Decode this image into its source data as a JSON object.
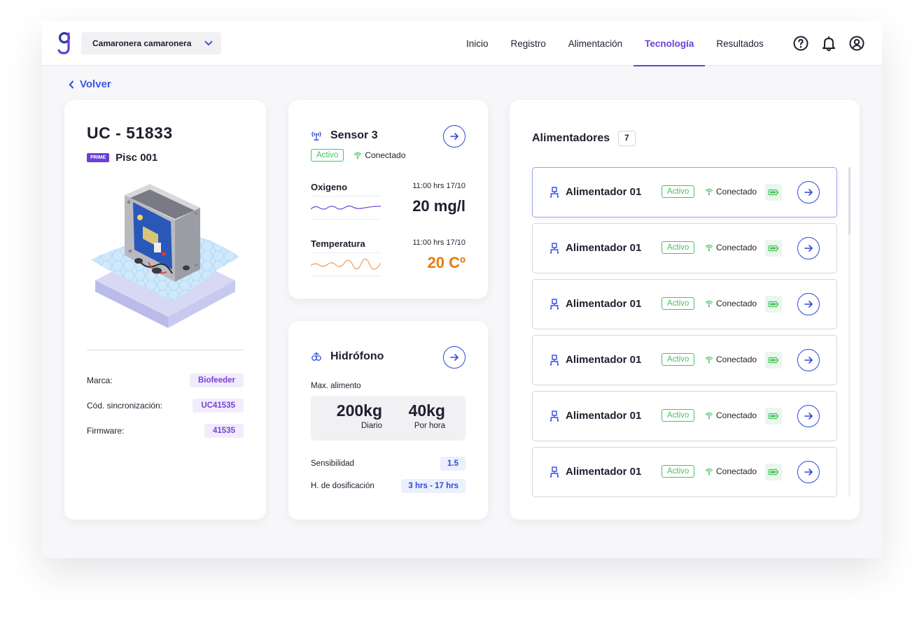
{
  "header": {
    "farm_select": "Camaronera camaronera",
    "nav": [
      "Inicio",
      "Registro",
      "Alimentación",
      "Tecnología",
      "Resultados"
    ],
    "active_nav": "Tecnología",
    "icons": [
      "help-icon",
      "bell-icon",
      "user-circle-icon"
    ]
  },
  "back_label": "Volver",
  "unit": {
    "title": "UC - 51833",
    "prime_badge": "PRIME",
    "pond": "Pisc 001",
    "specs": [
      {
        "label": "Marca:",
        "value": "Biofeeder"
      },
      {
        "label": "Cód. sincronización:",
        "value": "UC41535"
      },
      {
        "label": "Firmware:",
        "value": "41535"
      }
    ]
  },
  "sensor": {
    "title": "Sensor 3",
    "status": "Activo",
    "connection": "Conectado",
    "metrics": [
      {
        "name": "Oxigeno",
        "time": "11:00 hrs 17/10",
        "value": "20 mg/l",
        "color": "#1e1e2e",
        "wave_color": "#7b4ad9"
      },
      {
        "name": "Temperatura",
        "time": "11:00 hrs 17/10",
        "value": "20 Cº",
        "color": "#e87a0c",
        "wave_color": "#f29a55"
      }
    ]
  },
  "hydrophone": {
    "title": "Hidrófono",
    "max_label": "Max. alimento",
    "daily_value": "200kg",
    "daily_label": "Diario",
    "hourly_value": "40kg",
    "hourly_label": "Por hora",
    "sensitivity_label": "Sensibilidad",
    "sensitivity_value": "1.5",
    "dosing_label": "H. de dosificación",
    "dosing_value": "3 hrs - 17 hrs"
  },
  "feeders": {
    "title": "Alimentadores",
    "count": "7",
    "items": [
      {
        "name": "Alimentador 01",
        "status": "Activo",
        "connection": "Conectado"
      },
      {
        "name": "Alimentador 01",
        "status": "Activo",
        "connection": "Conectado"
      },
      {
        "name": "Alimentador 01",
        "status": "Activo",
        "connection": "Conectado"
      },
      {
        "name": "Alimentador 01",
        "status": "Activo",
        "connection": "Conectado"
      },
      {
        "name": "Alimentador 01",
        "status": "Activo",
        "connection": "Conectado"
      },
      {
        "name": "Alimentador 01",
        "status": "Activo",
        "connection": "Conectado"
      }
    ]
  },
  "colors": {
    "accent": "#6a3fd8",
    "link": "#2f47d9",
    "success": "#43c45f",
    "warning": "#e87a0c"
  }
}
